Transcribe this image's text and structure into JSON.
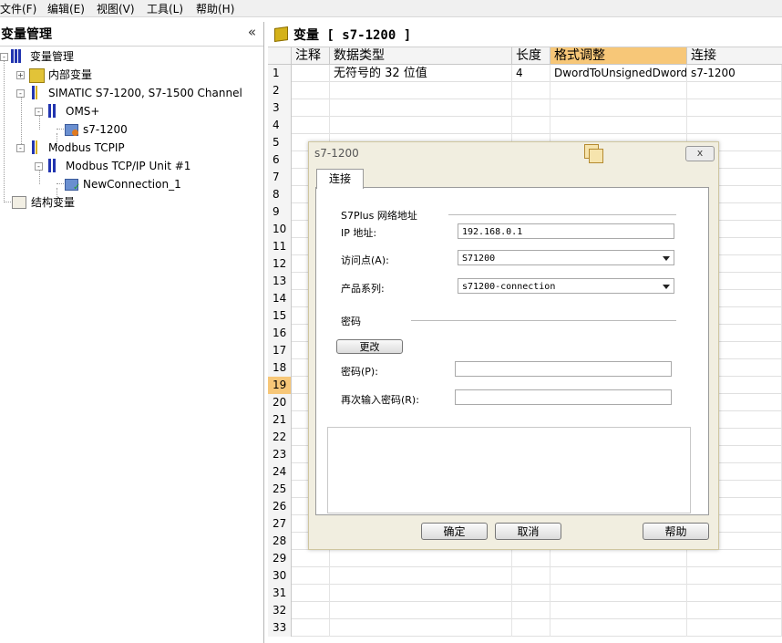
{
  "menu": [
    "文件(F)",
    "编辑(E)",
    "视图(V)",
    "工具(L)",
    "帮助(H)"
  ],
  "left_panel": {
    "title": "变量管理",
    "collapse_glyph": "«",
    "tree": [
      {
        "label": "变量管理",
        "expander": "-"
      },
      {
        "label": "内部变量",
        "expander": "+"
      },
      {
        "label": "SIMATIC S7-1200, S7-1500 Channel",
        "expander": "-"
      },
      {
        "label": "OMS+",
        "expander": "-"
      },
      {
        "label": "s7-1200",
        "expander": ""
      },
      {
        "label": "Modbus TCPIP",
        "expander": "-"
      },
      {
        "label": "Modbus TCP/IP Unit #1",
        "expander": "-"
      },
      {
        "label": "NewConnection_1",
        "expander": ""
      },
      {
        "label": "结构变量",
        "expander": ""
      }
    ]
  },
  "right_panel": {
    "title": "变量 [ s7-1200 ]",
    "columns": [
      "注释",
      "数据类型",
      "长度",
      "格式调整",
      "连接"
    ],
    "row_numbers": [
      "1",
      "2",
      "3",
      "4",
      "5",
      "6",
      "7",
      "8",
      "9",
      "10",
      "11",
      "12",
      "13",
      "14",
      "15",
      "16",
      "17",
      "18",
      "19",
      "20",
      "21",
      "22",
      "23",
      "24",
      "25",
      "26",
      "27",
      "28",
      "29",
      "30",
      "31",
      "32",
      "33"
    ],
    "selected_row": "19",
    "rows": [
      {
        "comment": "",
        "data_type": "无符号的 32 位值",
        "length": "4",
        "format": "DwordToUnsignedDword",
        "connection": "s7-1200"
      }
    ]
  },
  "dialog": {
    "title": "s7-1200",
    "close_glyph": "x",
    "tab": "连接",
    "group_address": "S7Plus 网络地址",
    "ip_label": "IP 地址:",
    "ip_value": "192.168.0.1",
    "access_label": "访问点(A):",
    "access_value": "S71200",
    "product_label": "产品系列:",
    "product_value": "s71200-connection",
    "group_password": "密码",
    "change_button": "更改",
    "password_label": "密码(P):",
    "password_value": "",
    "reenter_label": "再次输入密码(R):",
    "reenter_value": "",
    "ok": "确定",
    "cancel": "取消",
    "help": "帮助"
  }
}
